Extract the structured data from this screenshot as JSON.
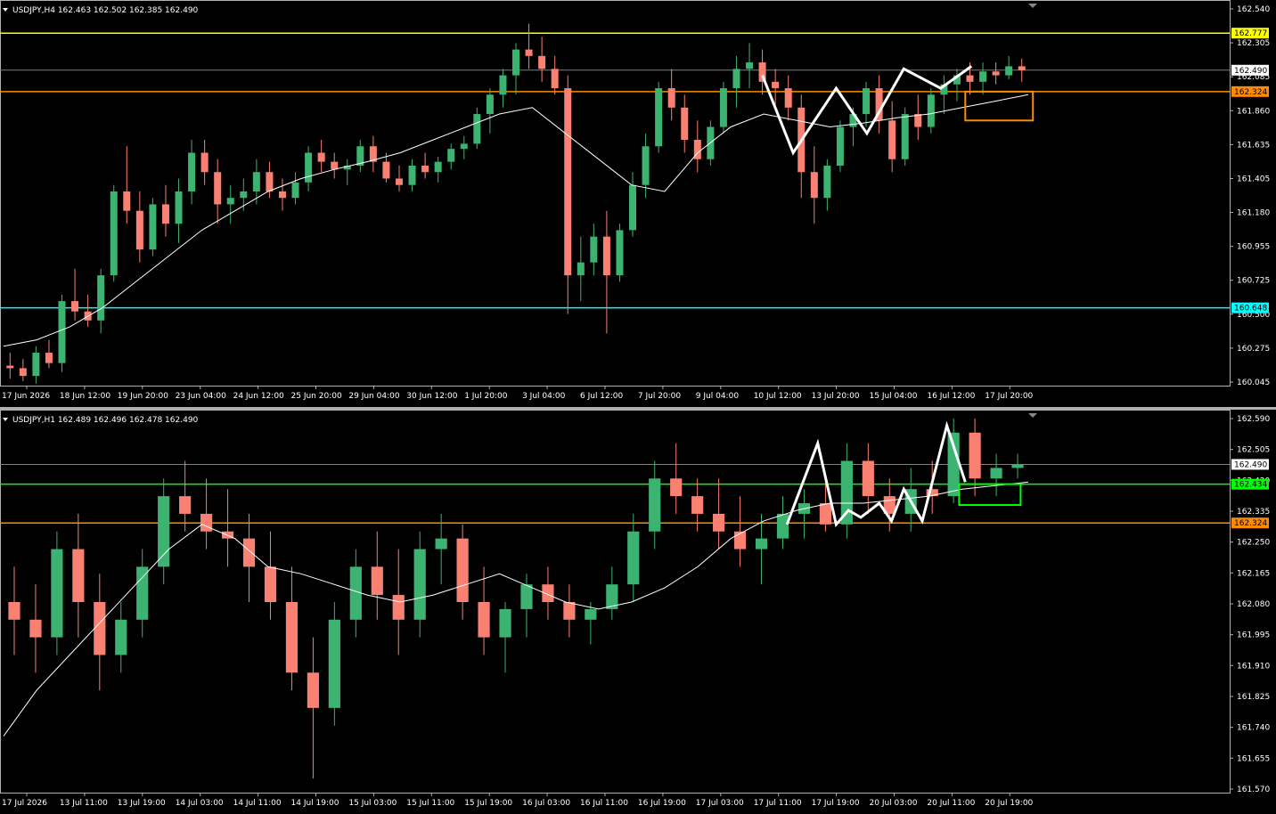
{
  "colors": {
    "background": "#000000",
    "bull": "#3cb371",
    "bear": "#fa8072",
    "ma": "#ffffff",
    "axis": "#b0b0b0",
    "yellow": "#ffff00",
    "orange": "#ff8c00",
    "cyan": "#00ffff",
    "green": "#00ff00",
    "current": "#808080"
  },
  "top": {
    "header": "USDJPY,H4  162.463 162.502 162.385 162.490",
    "collapse_icon": "triangle-down-icon",
    "price_axis": [
      "162.540",
      "162.305",
      "162.085",
      "161.860",
      "161.635",
      "161.405",
      "161.180",
      "160.955",
      "160.725",
      "160.500",
      "160.275",
      "160.045"
    ],
    "time_axis": [
      "17 Jun 2026",
      "18 Jun 12:00",
      "19 Jun 20:00",
      "23 Jun 04:00",
      "24 Jun 12:00",
      "25 Jun 20:00",
      "29 Jun 04:00",
      "30 Jun 12:00",
      "1 Jul 20:00",
      "3 Jul 04:00",
      "6 Jul 12:00",
      "7 Jul 20:00",
      "9 Jul 04:00",
      "10 Jul 12:00",
      "13 Jul 20:00",
      "15 Jul 04:00",
      "16 Jul 12:00",
      "17 Jul 20:00"
    ],
    "ymin": 160.045,
    "ymax": 163.02,
    "levels": [
      {
        "price": 162.777,
        "label": "162.777",
        "color": "#ffff00",
        "text_color": "#000000"
      },
      {
        "price": 162.324,
        "label": "162.324",
        "color": "#ff8c00",
        "text_color": "#000000"
      },
      {
        "price": 160.648,
        "label": "160.648",
        "color": "#00ffff",
        "text_color": "#000000"
      }
    ],
    "current": {
      "price": 162.49,
      "label": "162.490"
    },
    "candles": [
      [
        160.2,
        160.3,
        160.1,
        160.18
      ],
      [
        160.18,
        160.25,
        160.08,
        160.12
      ],
      [
        160.12,
        160.35,
        160.06,
        160.3
      ],
      [
        160.3,
        160.4,
        160.18,
        160.22
      ],
      [
        160.22,
        160.75,
        160.15,
        160.7
      ],
      [
        160.7,
        160.95,
        160.55,
        160.62
      ],
      [
        160.62,
        160.75,
        160.5,
        160.55
      ],
      [
        160.55,
        160.95,
        160.45,
        160.9
      ],
      [
        160.9,
        161.6,
        160.85,
        161.55
      ],
      [
        161.55,
        161.9,
        161.3,
        161.4
      ],
      [
        161.4,
        161.55,
        161.0,
        161.1
      ],
      [
        161.1,
        161.5,
        161.05,
        161.45
      ],
      [
        161.45,
        161.6,
        161.2,
        161.3
      ],
      [
        161.3,
        161.65,
        161.15,
        161.55
      ],
      [
        161.55,
        161.95,
        161.45,
        161.85
      ],
      [
        161.85,
        161.95,
        161.6,
        161.7
      ],
      [
        161.7,
        161.8,
        161.3,
        161.45
      ],
      [
        161.45,
        161.6,
        161.3,
        161.5
      ],
      [
        161.5,
        161.65,
        161.4,
        161.55
      ],
      [
        161.55,
        161.8,
        161.45,
        161.7
      ],
      [
        161.7,
        161.78,
        161.5,
        161.55
      ],
      [
        161.55,
        161.65,
        161.4,
        161.5
      ],
      [
        161.5,
        161.7,
        161.45,
        161.62
      ],
      [
        161.62,
        161.9,
        161.55,
        161.85
      ],
      [
        161.85,
        161.95,
        161.7,
        161.78
      ],
      [
        161.78,
        161.85,
        161.65,
        161.72
      ],
      [
        161.72,
        161.8,
        161.6,
        161.75
      ],
      [
        161.75,
        161.95,
        161.7,
        161.9
      ],
      [
        161.9,
        161.98,
        161.7,
        161.78
      ],
      [
        161.78,
        161.85,
        161.62,
        161.65
      ],
      [
        161.65,
        161.75,
        161.55,
        161.6
      ],
      [
        161.6,
        161.8,
        161.55,
        161.75
      ],
      [
        161.75,
        161.85,
        161.65,
        161.7
      ],
      [
        161.7,
        161.82,
        161.62,
        161.78
      ],
      [
        161.78,
        161.92,
        161.72,
        161.88
      ],
      [
        161.88,
        161.98,
        161.8,
        161.92
      ],
      [
        161.92,
        162.2,
        161.88,
        162.15
      ],
      [
        162.15,
        162.35,
        162.0,
        162.3
      ],
      [
        162.3,
        162.5,
        162.2,
        162.45
      ],
      [
        162.45,
        162.7,
        162.3,
        162.65
      ],
      [
        162.65,
        162.85,
        162.5,
        162.6
      ],
      [
        162.6,
        162.75,
        162.4,
        162.5
      ],
      [
        162.5,
        162.6,
        162.3,
        162.35
      ],
      [
        162.35,
        162.45,
        160.6,
        160.9
      ],
      [
        160.9,
        161.2,
        160.7,
        161.0
      ],
      [
        161.0,
        161.3,
        160.9,
        161.2
      ],
      [
        161.2,
        161.4,
        160.45,
        160.9
      ],
      [
        160.9,
        161.3,
        160.85,
        161.25
      ],
      [
        161.25,
        161.7,
        161.2,
        161.6
      ],
      [
        161.6,
        162.0,
        161.5,
        161.9
      ],
      [
        161.9,
        162.4,
        161.85,
        162.35
      ],
      [
        162.35,
        162.5,
        162.1,
        162.2
      ],
      [
        162.2,
        162.3,
        161.85,
        161.95
      ],
      [
        161.95,
        162.1,
        161.7,
        161.8
      ],
      [
        161.8,
        162.1,
        161.75,
        162.05
      ],
      [
        162.05,
        162.4,
        162.0,
        162.35
      ],
      [
        162.35,
        162.6,
        162.2,
        162.5
      ],
      [
        162.5,
        162.7,
        162.35,
        162.55
      ],
      [
        162.55,
        162.65,
        162.3,
        162.4
      ],
      [
        162.4,
        162.5,
        162.2,
        162.35
      ],
      [
        162.35,
        162.45,
        162.1,
        162.2
      ],
      [
        162.2,
        162.3,
        161.5,
        161.7
      ],
      [
        161.7,
        161.9,
        161.3,
        161.5
      ],
      [
        161.5,
        161.8,
        161.4,
        161.75
      ],
      [
        161.75,
        162.1,
        161.7,
        162.05
      ],
      [
        162.05,
        162.2,
        161.9,
        162.15
      ],
      [
        162.15,
        162.4,
        162.05,
        162.35
      ],
      [
        162.35,
        162.45,
        162.0,
        162.1
      ],
      [
        162.1,
        162.25,
        161.7,
        161.8
      ],
      [
        161.8,
        162.2,
        161.75,
        162.15
      ],
      [
        162.15,
        162.3,
        161.95,
        162.05
      ],
      [
        162.05,
        162.35,
        162.0,
        162.3
      ],
      [
        162.3,
        162.45,
        162.15,
        162.38
      ],
      [
        162.38,
        162.5,
        162.25,
        162.45
      ],
      [
        162.45,
        162.55,
        162.3,
        162.4
      ],
      [
        162.4,
        162.55,
        162.3,
        162.48
      ],
      [
        162.48,
        162.55,
        162.38,
        162.45
      ],
      [
        162.45,
        162.6,
        162.42,
        162.52
      ],
      [
        162.52,
        162.58,
        162.4,
        162.49
      ]
    ],
    "ma": [
      160.35,
      160.4,
      160.5,
      160.65,
      160.85,
      161.05,
      161.25,
      161.4,
      161.55,
      161.65,
      161.72,
      161.78,
      161.85,
      161.95,
      162.05,
      162.15,
      162.2,
      162.0,
      161.8,
      161.6,
      161.55,
      161.85,
      162.05,
      162.15,
      162.1,
      162.05,
      162.08,
      162.12,
      162.15,
      162.2,
      162.25,
      162.3
    ],
    "pattern": [
      [
        0.62,
        162.45
      ],
      [
        0.645,
        161.85
      ],
      [
        0.68,
        162.35
      ],
      [
        0.705,
        162.0
      ],
      [
        0.735,
        162.5
      ],
      [
        0.765,
        162.35
      ],
      [
        0.79,
        162.52
      ]
    ],
    "box": {
      "x1": 0.785,
      "x2": 0.84,
      "y_top": 162.324,
      "y_bottom": 162.1,
      "color": "#ff8c00"
    }
  },
  "bottom": {
    "header": "USDJPY,H1  162.489 162.496 162.478 162.490",
    "collapse_icon": "triangle-down-icon",
    "price_axis": [
      "162.590",
      "162.505",
      "162.420",
      "162.335",
      "162.250",
      "162.165",
      "162.080",
      "161.995",
      "161.910",
      "161.825",
      "161.740",
      "161.655",
      "161.570"
    ],
    "time_axis": [
      "17 Jul 2026",
      "13 Jul 11:00",
      "13 Jul 19:00",
      "14 Jul 03:00",
      "14 Jul 11:00",
      "14 Jul 19:00",
      "15 Jul 03:00",
      "15 Jul 11:00",
      "15 Jul 19:00",
      "16 Jul 03:00",
      "16 Jul 11:00",
      "16 Jul 19:00",
      "17 Jul 03:00",
      "17 Jul 11:00",
      "17 Jul 19:00",
      "20 Jul 03:00",
      "20 Jul 11:00",
      "20 Jul 19:00"
    ],
    "ymin": 161.56,
    "ymax": 162.64,
    "levels": [
      {
        "price": 162.434,
        "label": "162.434",
        "color": "#00ff00",
        "text_color": "#000000"
      },
      {
        "price": 162.324,
        "label": "162.324",
        "color": "#ff8c00",
        "text_color": "#000000"
      }
    ],
    "current": {
      "price": 162.49,
      "label": "162.490"
    },
    "candles": [
      [
        162.1,
        162.2,
        161.95,
        162.05
      ],
      [
        162.05,
        162.15,
        161.9,
        162.0
      ],
      [
        162.0,
        162.3,
        161.95,
        162.25
      ],
      [
        162.25,
        162.35,
        162.0,
        162.1
      ],
      [
        162.1,
        162.18,
        161.85,
        161.95
      ],
      [
        161.95,
        162.1,
        161.9,
        162.05
      ],
      [
        162.05,
        162.25,
        162.0,
        162.2
      ],
      [
        162.2,
        162.45,
        162.15,
        162.4
      ],
      [
        162.4,
        162.5,
        162.3,
        162.35
      ],
      [
        162.35,
        162.45,
        162.25,
        162.3
      ],
      [
        162.3,
        162.42,
        162.2,
        162.28
      ],
      [
        162.28,
        162.35,
        162.1,
        162.2
      ],
      [
        162.2,
        162.3,
        162.05,
        162.1
      ],
      [
        162.1,
        162.2,
        161.85,
        161.9
      ],
      [
        161.9,
        162.0,
        161.6,
        161.8
      ],
      [
        161.8,
        162.1,
        161.75,
        162.05
      ],
      [
        162.05,
        162.25,
        162.0,
        162.2
      ],
      [
        162.2,
        162.3,
        162.05,
        162.12
      ],
      [
        162.12,
        162.25,
        161.95,
        162.05
      ],
      [
        162.05,
        162.3,
        162.0,
        162.25
      ],
      [
        162.25,
        162.35,
        162.15,
        162.28
      ],
      [
        162.28,
        162.32,
        162.05,
        162.1
      ],
      [
        162.1,
        162.2,
        161.95,
        162.0
      ],
      [
        162.0,
        162.1,
        161.9,
        162.08
      ],
      [
        162.08,
        162.18,
        162.0,
        162.15
      ],
      [
        162.15,
        162.2,
        162.05,
        162.1
      ],
      [
        162.1,
        162.15,
        162.0,
        162.05
      ],
      [
        162.05,
        162.1,
        161.98,
        162.08
      ],
      [
        162.08,
        162.2,
        162.05,
        162.15
      ],
      [
        162.15,
        162.35,
        162.1,
        162.3
      ],
      [
        162.3,
        162.5,
        162.25,
        162.45
      ],
      [
        162.45,
        162.55,
        162.35,
        162.4
      ],
      [
        162.4,
        162.45,
        162.3,
        162.35
      ],
      [
        162.35,
        162.45,
        162.25,
        162.3
      ],
      [
        162.3,
        162.4,
        162.2,
        162.25
      ],
      [
        162.25,
        162.35,
        162.15,
        162.28
      ],
      [
        162.28,
        162.4,
        162.25,
        162.35
      ],
      [
        162.35,
        162.42,
        162.28,
        162.38
      ],
      [
        162.38,
        162.45,
        162.3,
        162.32
      ],
      [
        162.32,
        162.55,
        162.28,
        162.5
      ],
      [
        162.5,
        162.55,
        162.35,
        162.4
      ],
      [
        162.4,
        162.45,
        162.3,
        162.35
      ],
      [
        162.35,
        162.48,
        162.3,
        162.42
      ],
      [
        162.42,
        162.5,
        162.35,
        162.4
      ],
      [
        162.4,
        162.62,
        162.38,
        162.58
      ],
      [
        162.58,
        162.62,
        162.4,
        162.45
      ],
      [
        162.45,
        162.52,
        162.4,
        162.48
      ],
      [
        162.48,
        162.52,
        162.45,
        162.49
      ]
    ],
    "ma": [
      161.72,
      161.85,
      161.95,
      162.05,
      162.15,
      162.25,
      162.32,
      162.28,
      162.2,
      162.18,
      162.15,
      162.12,
      162.1,
      162.12,
      162.15,
      162.18,
      162.14,
      162.1,
      162.08,
      162.1,
      162.14,
      162.2,
      162.28,
      162.33,
      162.36,
      162.38,
      162.38,
      162.39,
      162.4,
      162.42,
      162.43,
      162.44
    ],
    "pattern": [
      [
        0.64,
        162.32
      ],
      [
        0.665,
        162.55
      ],
      [
        0.68,
        162.32
      ],
      [
        0.69,
        162.36
      ],
      [
        0.7,
        162.34
      ],
      [
        0.715,
        162.38
      ],
      [
        0.725,
        162.33
      ],
      [
        0.735,
        162.42
      ],
      [
        0.75,
        162.33
      ],
      [
        0.77,
        162.6
      ],
      [
        0.785,
        162.44
      ]
    ],
    "box": {
      "x1": 0.78,
      "x2": 0.83,
      "y_top": 162.434,
      "y_bottom": 162.375,
      "color": "#00ff00"
    }
  }
}
